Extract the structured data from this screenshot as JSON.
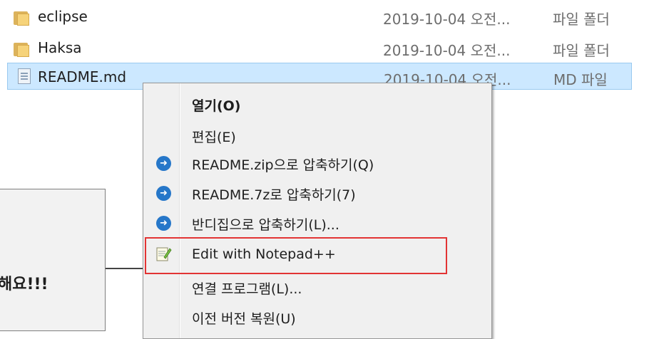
{
  "files": [
    {
      "name": "eclipse",
      "date": "2019-10-04 오전...",
      "type": "파일 폴더",
      "icon": "folder-icon",
      "selected": false
    },
    {
      "name": "Haksa",
      "date": "2019-10-04 오전...",
      "type": "파일 폴더",
      "icon": "folder-icon",
      "selected": false
    },
    {
      "name": "README.md",
      "date": "2019-10-04 오전...",
      "type": "MD 파일",
      "icon": "document-icon",
      "selected": true
    }
  ],
  "context_menu": {
    "items": [
      {
        "label": "열기(O)",
        "bold": true,
        "icon": null
      },
      {
        "label": "편집(E)",
        "bold": false,
        "icon": null
      },
      {
        "label": "README.zip으로 압축하기(Q)",
        "bold": false,
        "icon": "bandizip-icon"
      },
      {
        "label": "README.7z로 압축하기(7)",
        "bold": false,
        "icon": "bandizip-icon"
      },
      {
        "label": "반디집으로 압축하기(L)...",
        "bold": false,
        "icon": "bandizip-icon"
      },
      {
        "label": "Edit with Notepad++",
        "bold": false,
        "icon": "notepad-plus-plus-icon",
        "highlighted": true
      },
      {
        "label": "연결 프로그램(L)...",
        "bold": false,
        "icon": null
      },
      {
        "label": "이전 버전 복원(U)",
        "bold": false,
        "icon": null
      }
    ]
  },
  "callout": {
    "text": "해요!!!"
  },
  "colors": {
    "selection_bg": "#cce8ff",
    "selection_border": "#99c9ef",
    "highlight_border": "#e23434",
    "bandizip_blue": "#2677c9"
  }
}
